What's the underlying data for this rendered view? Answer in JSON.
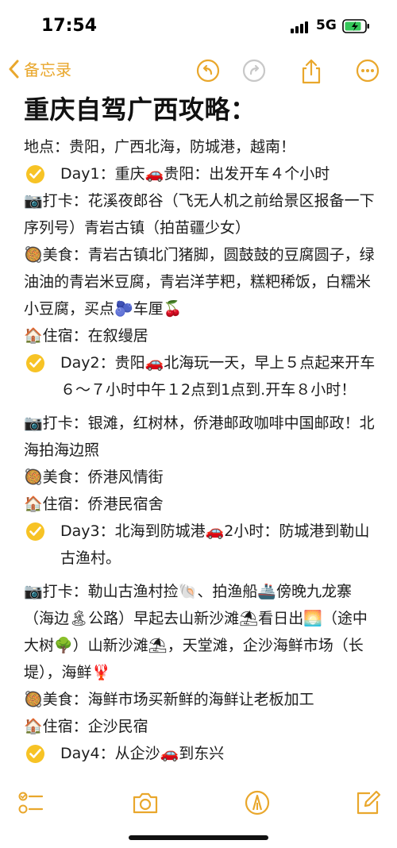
{
  "status_bar": {
    "time": "17:54",
    "network": "5G"
  },
  "nav": {
    "back_label": "备忘录"
  },
  "note": {
    "title": "重庆自驾广西攻略：",
    "lines": [
      "地点：贵阳，广西北海，防城港，越南！",
      "Day1：重庆🚗贵阳：出发开车４个小时",
      "📷打卡：花溪夜郎谷（飞无人机之前给景区报备一下序列号）青岩古镇（拍苗疆少女）",
      "🥘美食：青岩古镇北门猪脚，圆鼓鼓的豆腐圆子，绿油油的青岩米豆腐，青岩洋芋粑，糕粑稀饭，白糯米小豆腐，买点🫐车厘🍒",
      "🏠住宿：在叙缦居",
      "Day2：贵阳🚗北海玩一天，早上５点起来开车６～７小时中午１2点到1点到.开车８小时！",
      "📷打卡：银滩，红树林，侨港邮政咖啡中国邮政！北海拍海边照",
      "🥘美食：侨港风情街",
      "🏠住宿：侨港民宿舍",
      "Day3：北海到防城港🚗2小时：防城港到勒山古渔村。",
      "📷打卡：勒山古渔村捡🐚、拍渔船🚢傍晚九龙寨（海边🏝公路）早起去山新沙滩⛱看日出🌅（途中大树🌳）山新沙滩⛱，天堂滩，企沙海鲜市场（长堤），海鲜🦞",
      "🥘美食：海鲜市场买新鲜的海鲜让老板加工",
      "🏠住宿：企沙民宿",
      "Day4：从企沙🚗到东兴"
    ]
  },
  "colors": {
    "accent": "#E9A72C",
    "check_yellow": "#F7C325"
  },
  "icons": {
    "back": "chevron-left-icon",
    "undo": "undo-icon",
    "redo": "redo-icon",
    "share": "share-icon",
    "more": "more-icon",
    "checklist": "checklist-icon",
    "camera": "camera-icon",
    "markup": "pen-tip-icon",
    "compose": "compose-icon"
  }
}
